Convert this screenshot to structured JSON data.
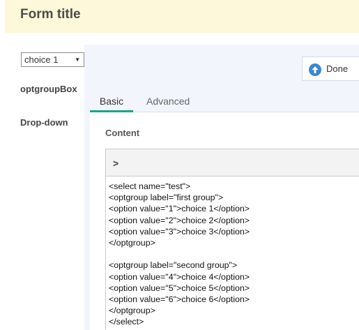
{
  "form": {
    "title": "Form title"
  },
  "sidebar": {
    "select_value": "choice 1",
    "items": [
      {
        "label": "optgroupBox"
      },
      {
        "label": "Drop-down"
      }
    ]
  },
  "toolbar": {
    "done_label": "Done"
  },
  "tabs": [
    {
      "label": "Basic",
      "active": true
    },
    {
      "label": "Advanced",
      "active": false
    }
  ],
  "content": {
    "label": "Content",
    "code_lines": [
      "<select name=\"test\">",
      "<optgroup label=\"first group\">",
      "<option value=\"1\">choice 1</option>",
      "<option value=\"2\">choice 2</option>",
      "<option value=\"3\">choice 3</option>",
      "</optgroup>",
      "",
      "<optgroup label=\"second group\">",
      "<option value=\"4\">choice 4</option>",
      "<option value=\"5\">choice 5</option>",
      "<option value=\"6\">choice 6</option>",
      "</optgroup>",
      "</select>"
    ]
  },
  "colors": {
    "title_bg": "#fdf8d9",
    "panel_bg": "#f2f5fb",
    "accent": "#17a68a",
    "done_icon": "#3a87d2"
  },
  "icons": {
    "done": "arrow-up-circle-icon",
    "editor_toggle": "chevron-right-icon",
    "select": "caret-down-icon"
  }
}
